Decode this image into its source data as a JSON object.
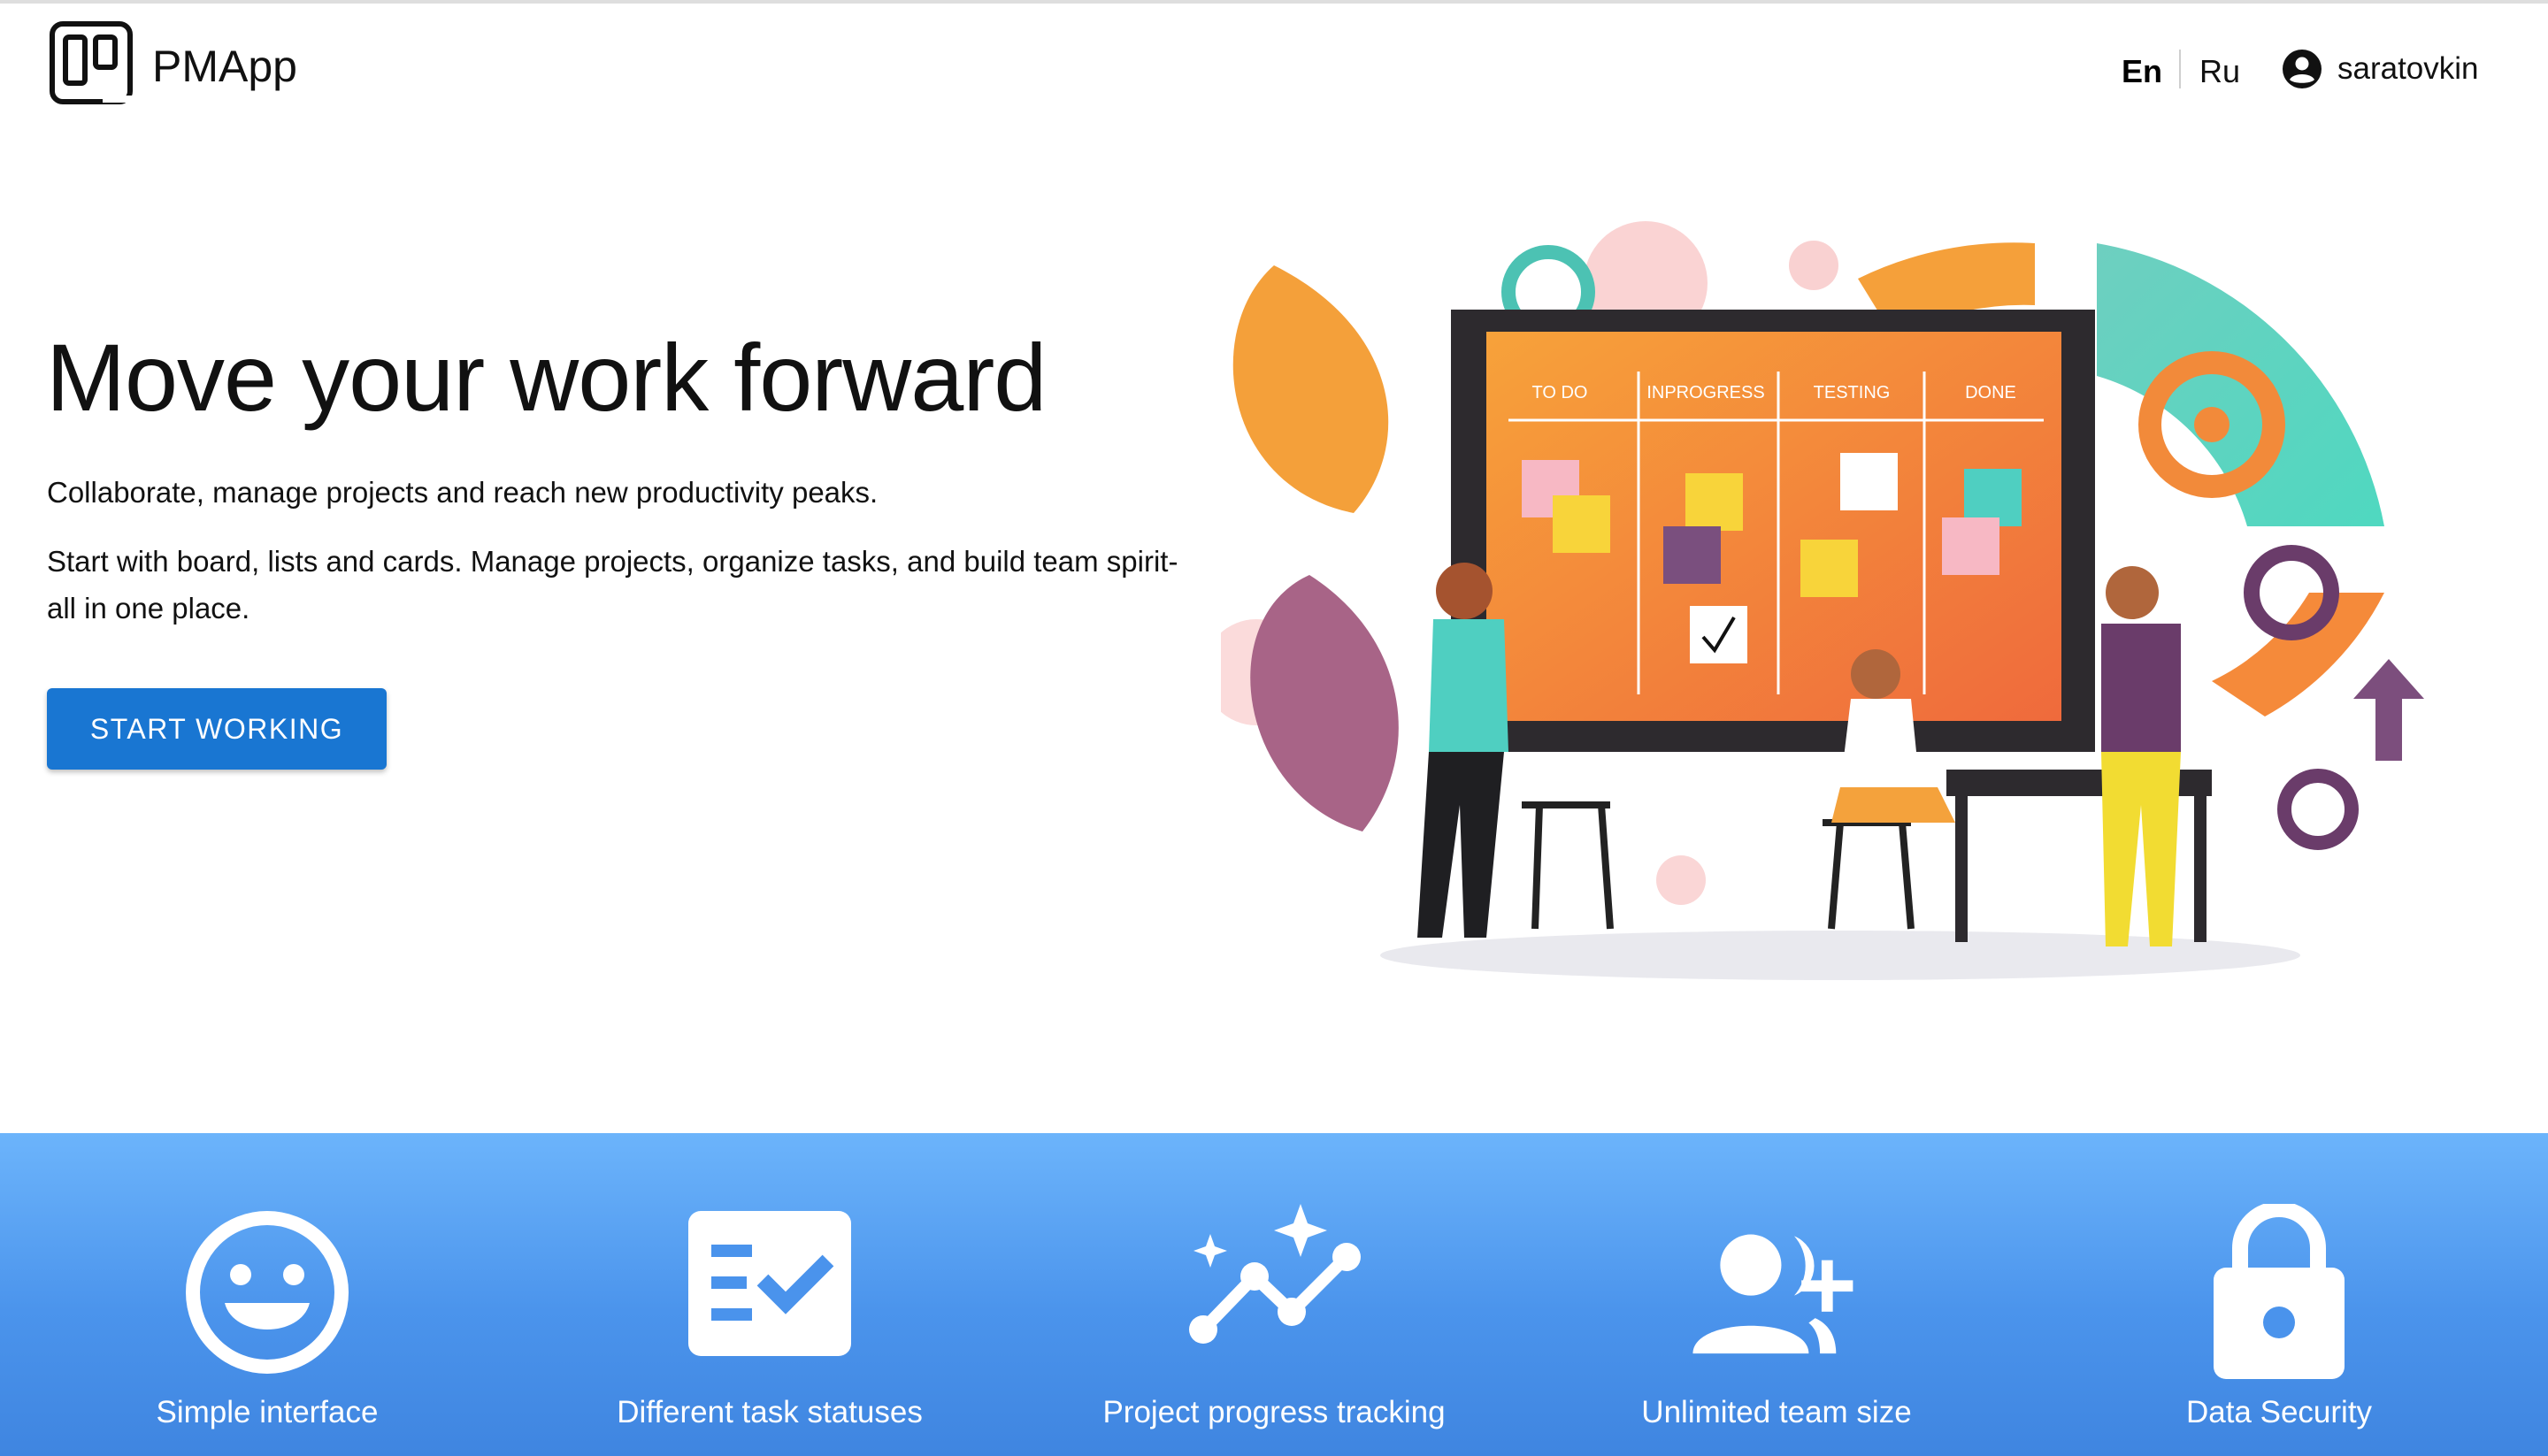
{
  "header": {
    "brand": "PMApp",
    "languages": {
      "en": "En",
      "ru": "Ru",
      "active": "En"
    },
    "user": {
      "icon": "account-circle-icon",
      "name": "saratovkin"
    }
  },
  "hero": {
    "title": "Move your work forward",
    "subtitle": "Collaborate, manage projects and reach new productivity peaks.",
    "description": "Start with board, lists and cards. Manage projects, organize tasks, and build team spirit-all in one place.",
    "cta_label": "START WORKING",
    "illustration": {
      "columns": [
        "TO DO",
        "INPROGRESS",
        "TESTING",
        "DONE"
      ]
    }
  },
  "features": [
    {
      "icon": "smiley-icon",
      "label": "Simple interface"
    },
    {
      "icon": "checklist-icon",
      "label": "Different task statuses"
    },
    {
      "icon": "trend-sparkle-icon",
      "label": "Project progress tracking"
    },
    {
      "icon": "group-add-icon",
      "label": "Unlimited team size"
    },
    {
      "icon": "lock-icon",
      "label": "Data Security"
    }
  ],
  "colors": {
    "primary": "#1976d2",
    "features_gradient_top": "#6cb4fb",
    "features_gradient_bottom": "#3f85e0"
  }
}
